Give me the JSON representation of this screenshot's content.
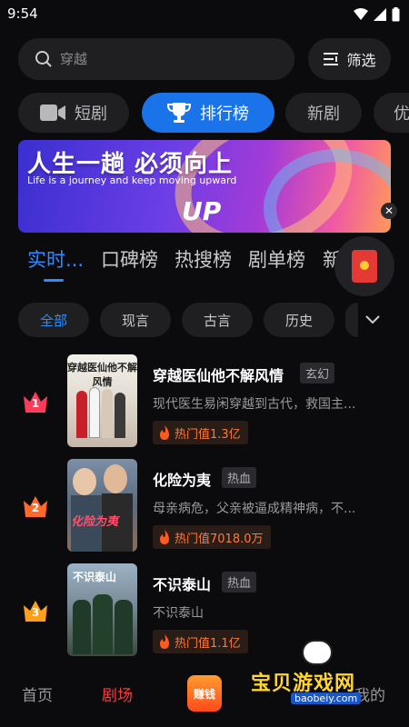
{
  "status": {
    "time": "9:54"
  },
  "search": {
    "placeholder": "穿越"
  },
  "filter": {
    "label": "筛选"
  },
  "categories": [
    {
      "label": "短剧",
      "icon": "video-camera-icon"
    },
    {
      "label": "排行榜",
      "icon": "trophy-icon"
    },
    {
      "label": "新剧"
    },
    {
      "label": "优"
    }
  ],
  "banner": {
    "title": "人生一趟  必须向上",
    "subtitle": "Life is a journey and  keep moving upward",
    "logo": "UP"
  },
  "rank_tabs": [
    "实时...",
    "口碑榜",
    "热搜榜",
    "剧单榜",
    "新剧榜"
  ],
  "genres": [
    "全部",
    "现言",
    "古言",
    "历史",
    "都"
  ],
  "items": [
    {
      "rank": "1",
      "poster_title": "穿越医仙他不解风情",
      "title": "穿越医仙他不解风情",
      "tag": "玄幻",
      "desc": "现代医生易闲穿越到古代，救国主...",
      "heat": "热门值1.3亿"
    },
    {
      "rank": "2",
      "poster_title": "化险为夷",
      "title": "化险为夷",
      "tag": "热血",
      "desc": "母亲病危，父亲被逼成精神病，不...",
      "heat": "热门值7018.0万"
    },
    {
      "rank": "3",
      "poster_title": "不识泰山",
      "title": "不识泰山",
      "tag": "热血",
      "desc": "不识泰山",
      "heat": "热门值1.1亿"
    }
  ],
  "colors": {
    "accent": "#1a73e8",
    "rank1": "#ff3b5c",
    "rank2": "#ff6a2c",
    "rank3": "#ff9f1a",
    "nav_active": "#ff3b3b"
  },
  "nav": {
    "home": "首页",
    "theater": "剧场",
    "earn": "赚钱",
    "mine": "我的"
  },
  "watermark": {
    "text": "宝贝游戏网",
    "url": "baobeiy.com"
  }
}
